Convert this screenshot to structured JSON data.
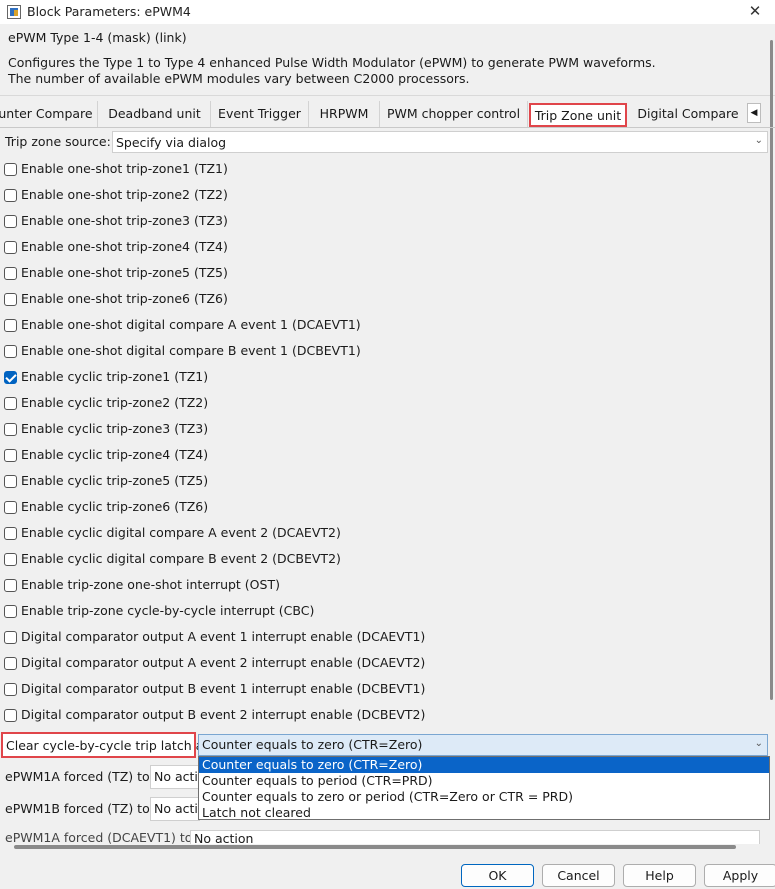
{
  "window": {
    "title": "Block Parameters: ePWM4",
    "close_glyph": "✕",
    "icon": "block-parameters-icon"
  },
  "mask": {
    "type_line": "ePWM Type 1-4 (mask) (link)",
    "desc_line1": "Configures the Type 1 to Type 4 enhanced Pulse Width Modulator (ePWM) to generate PWM waveforms.",
    "desc_line2": "The number of available ePWM modules vary between C2000 processors."
  },
  "tabs": {
    "items": [
      {
        "label": "unter Compare"
      },
      {
        "label": "Deadband unit"
      },
      {
        "label": "Event Trigger"
      },
      {
        "label": "HRPWM"
      },
      {
        "label": "PWM chopper control"
      },
      {
        "label": "Trip Zone unit"
      },
      {
        "label": "Digital Compare"
      }
    ],
    "active": "Trip Zone unit",
    "scroll_glyph": "◀"
  },
  "trip_source": {
    "label": "Trip zone source:",
    "value": "Specify via dialog"
  },
  "checkboxes": [
    {
      "label": "Enable one-shot trip-zone1 (TZ1)",
      "checked": false
    },
    {
      "label": "Enable one-shot trip-zone2 (TZ2)",
      "checked": false
    },
    {
      "label": "Enable one-shot trip-zone3 (TZ3)",
      "checked": false
    },
    {
      "label": "Enable one-shot trip-zone4 (TZ4)",
      "checked": false
    },
    {
      "label": "Enable one-shot trip-zone5 (TZ5)",
      "checked": false
    },
    {
      "label": "Enable one-shot trip-zone6 (TZ6)",
      "checked": false
    },
    {
      "label": "Enable one-shot digital compare A event 1 (DCAEVT1)",
      "checked": false
    },
    {
      "label": "Enable one-shot digital compare B event 1 (DCBEVT1)",
      "checked": false
    },
    {
      "label": "Enable cyclic trip-zone1 (TZ1)",
      "checked": true
    },
    {
      "label": "Enable cyclic trip-zone2 (TZ2)",
      "checked": false
    },
    {
      "label": "Enable cyclic trip-zone3 (TZ3)",
      "checked": false
    },
    {
      "label": "Enable cyclic trip-zone4 (TZ4)",
      "checked": false
    },
    {
      "label": "Enable cyclic trip-zone5 (TZ5)",
      "checked": false
    },
    {
      "label": "Enable cyclic trip-zone6 (TZ6)",
      "checked": false
    },
    {
      "label": "Enable cyclic digital compare A event 2 (DCAEVT2)",
      "checked": false
    },
    {
      "label": "Enable cyclic digital compare B event 2 (DCBEVT2)",
      "checked": false
    },
    {
      "label": "Enable trip-zone one-shot interrupt (OST)",
      "checked": false
    },
    {
      "label": "Enable trip-zone cycle-by-cycle interrupt (CBC)",
      "checked": false
    },
    {
      "label": "Digital comparator output A event 1 interrupt enable (DCAEVT1)",
      "checked": false
    },
    {
      "label": "Digital comparator output A event 2 interrupt enable (DCAEVT2)",
      "checked": false
    },
    {
      "label": "Digital comparator output B event 1 interrupt enable (DCBEVT1)",
      "checked": false
    },
    {
      "label": "Digital comparator output B event 2 interrupt enable (DCBEVT2)",
      "checked": false
    }
  ],
  "latch": {
    "label": "Clear cycle-by-cycle trip latch at:",
    "value": "Counter equals to zero (CTR=Zero)",
    "options": [
      "Counter equals to zero (CTR=Zero)",
      "Counter equals to period (CTR=PRD)",
      "Counter equals to zero or period (CTR=Zero or CTR = PRD)",
      "Latch not cleared"
    ],
    "selected_index": 0
  },
  "forced": [
    {
      "label": "ePWM1A forced (TZ) to:",
      "value": "No actio"
    },
    {
      "label": "ePWM1B forced (TZ) to:",
      "value": "No actio"
    },
    {
      "label": "ePWM1A forced (DCAEVT1) to:",
      "value": "No action"
    }
  ],
  "buttons": {
    "ok": "OK",
    "cancel": "Cancel",
    "help": "Help",
    "apply": "Apply"
  },
  "colors": {
    "highlight_border": "#e0454a",
    "selection_blue": "#0a64c8",
    "checkbox_checked": "#0063c1"
  }
}
